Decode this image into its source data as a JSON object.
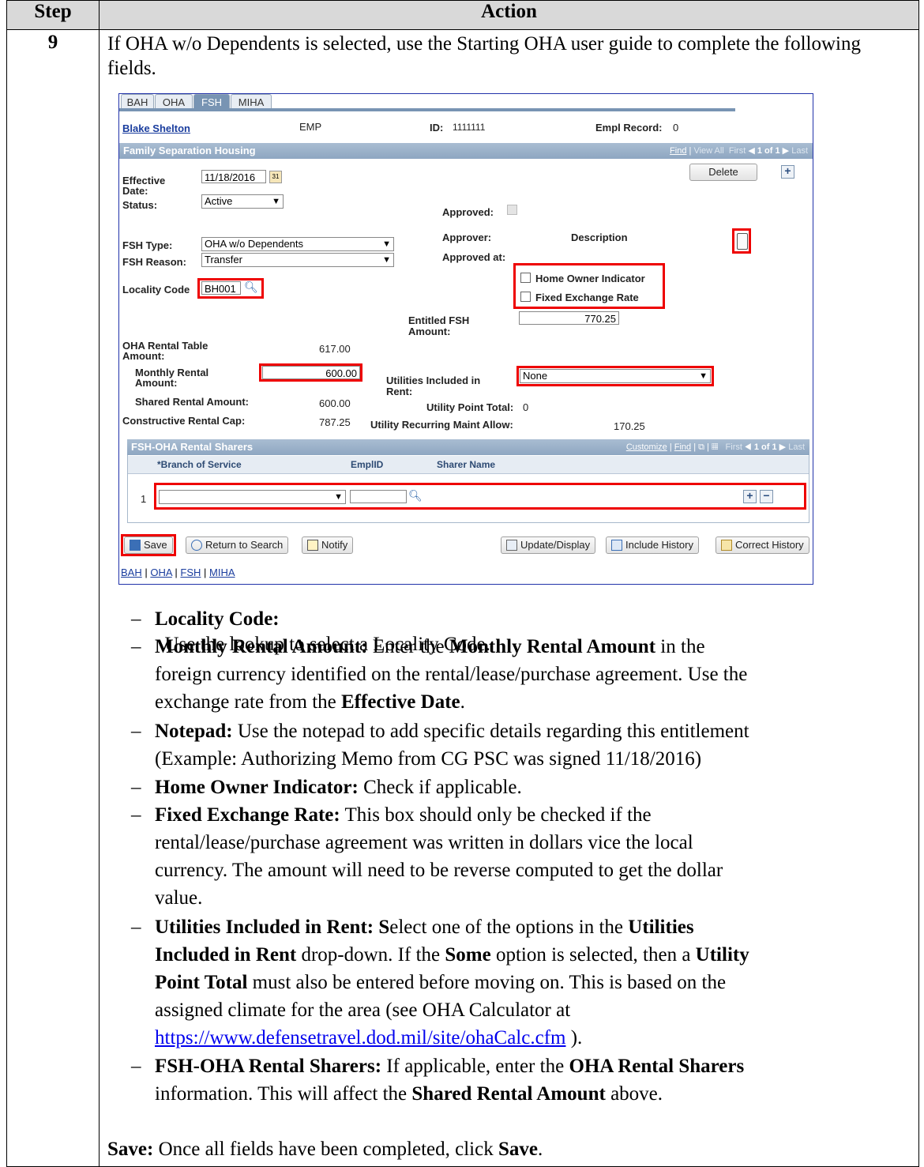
{
  "table": {
    "col_step": "Step",
    "col_action": "Action",
    "step_no": "9",
    "intro": "If OHA w/o Dependents is selected, use the Starting OHA user guide to complete the following fields."
  },
  "screenshot": {
    "tabs": [
      "BAH",
      "OHA",
      "FSH",
      "MIHA"
    ],
    "active_tab": "FSH",
    "employee_name": "Blake Shelton",
    "emp_type": "EMP",
    "id_label": "ID:",
    "id_value": "1111111",
    "empl_record_label": "Empl Record:",
    "empl_record_value": "0",
    "section_title": "Family Separation Housing",
    "nav": {
      "find": "Find",
      "view_all": "View All",
      "first": "First",
      "count": "1 of 1",
      "last": "Last"
    },
    "delete_label": "Delete",
    "effective_date_label": "Effective Date:",
    "effective_date_value": "11/18/2016",
    "status_label": "Status:",
    "status_value": "Active",
    "approved_label": "Approved:",
    "approver_label": "Approver:",
    "description_label": "Description",
    "approved_at_label": "Approved at:",
    "fsh_type_label": "FSH Type:",
    "fsh_type_value": "OHA w/o Dependents",
    "fsh_reason_label": "FSH Reason:",
    "fsh_reason_value": "Transfer",
    "home_owner_label": "Home Owner Indicator",
    "fixed_exchange_label": "Fixed Exchange Rate",
    "locality_label": "Locality Code",
    "locality_value": "BH001",
    "entitled_fsh_label": "Entitled FSH Amount:",
    "entitled_fsh_value": "770.25",
    "oha_rental_table_label": "OHA Rental Table Amount:",
    "oha_rental_table_value": "617.00",
    "monthly_rental_label": "Monthly Rental Amount:",
    "monthly_rental_value": "600.00",
    "utilities_label": "Utilities Included in Rent:",
    "utilities_value": "None",
    "shared_rental_label": "Shared Rental Amount:",
    "shared_rental_value": "600.00",
    "utility_point_label": "Utility Point Total:",
    "utility_point_value": "0",
    "constructive_cap_label": "Constructive Rental Cap:",
    "constructive_cap_value": "787.25",
    "utility_maint_label": "Utility Recurring Maint Allow:",
    "utility_maint_value": "170.25",
    "sharers_title": "FSH-OHA Rental Sharers",
    "sharers_nav": {
      "customize": "Customize",
      "find": "Find",
      "first": "First",
      "count": "1 of 1",
      "last": "Last"
    },
    "sharers_cols": [
      "*Branch of Service",
      "EmplID",
      "Sharer Name"
    ],
    "sharers_row_no": "1",
    "buttons": {
      "save": "Save",
      "return": "Return to Search",
      "notify": "Notify",
      "update": "Update/Display",
      "include": "Include History",
      "correct": "Correct History"
    },
    "footer_links": [
      "BAH",
      "OHA",
      "FSH",
      "MIHA"
    ]
  },
  "bullets": {
    "b1_bold": "Locality Code:",
    "b1_text": "  Use the lookup to select a Locality Code.",
    "b2_l1_bold": "Monthly Rental Amount:",
    "b2_l1_text": " Enter the ",
    "b2_l1_bold2": "Monthly Rental Amount",
    "b2_l1_text2": " in the",
    "b2_l2": "foreign currency identified on the rental/lease/purchase agreement. Use the",
    "b2_l3_text": "exchange rate from the ",
    "b2_l3_bold": "Effective Date",
    "b2_l3_end": ".",
    "b3_bold": "Notepad:",
    "b3_text": " Use the notepad to add specific details regarding this entitlement",
    "b3_l2": "(Example: Authorizing Memo from CG PSC was signed 11/18/2016)",
    "b4_bold": "Home Owner Indicator:",
    "b4_text": " Check if applicable.",
    "b5_bold": "Fixed Exchange Rate:",
    "b5_text": " This box should only be checked if the",
    "b5_l2": "rental/lease/purchase agreement was written in dollars vice the local",
    "b5_l3": "currency. The amount will need to be reverse computed to get the dollar",
    "b5_l4": "value.",
    "b6_bold": "Utilities Included in Rent: S",
    "b6_text": "elect one of the options in the ",
    "b6_bold2": "Utilities",
    "b6_l2_bold": "Included in Rent",
    "b6_l2_text": " drop-down. If the ",
    "b6_l2_bold2": "Some",
    "b6_l2_text2": " option is selected, then a ",
    "b6_l2_bold3": "Utility",
    "b6_l3_bold": "Point Total",
    "b6_l3_text": " must also be entered before moving on. This is based on the",
    "b6_l4": "assigned climate for the area (see OHA Calculator at",
    "b6_l5_url": "https://www.defensetravel.dod.mil/site/ohaCalc.cfm",
    "b6_l5_end": " ).",
    "b7_bold": "FSH-OHA Rental Sharers:",
    "b7_text": " If applicable, enter the ",
    "b7_bold2": "OHA Rental Sharers",
    "b7_l2_text": "information. This will affect the ",
    "b7_l2_bold": "Shared Rental Amount",
    "b7_l2_end": " above.",
    "save_bold": "Save:",
    "save_text": " Once all fields have been completed, click ",
    "save_bold2": "Save",
    "save_end": "."
  }
}
